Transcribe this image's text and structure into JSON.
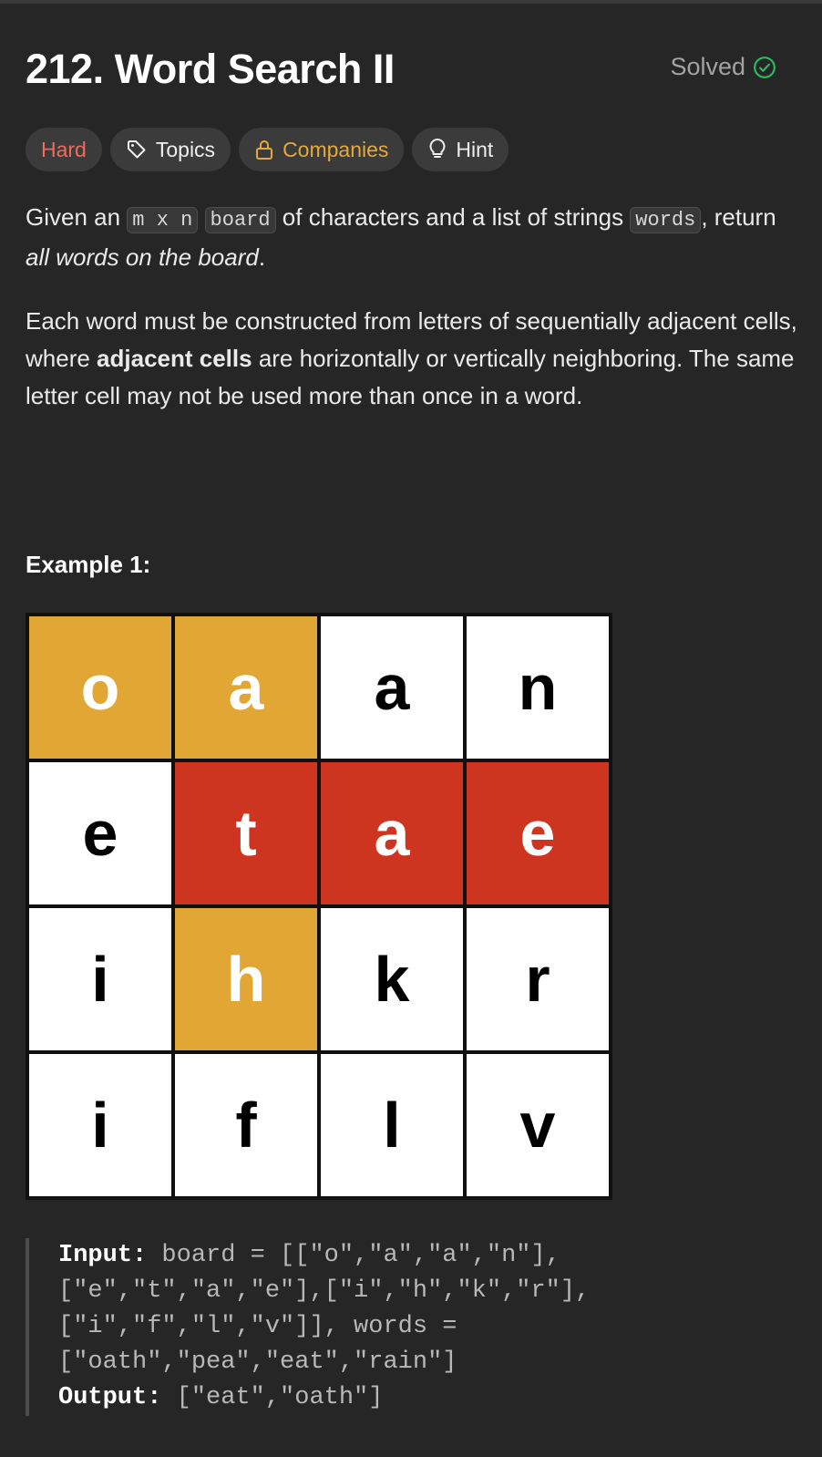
{
  "problem": {
    "title": "212. Word Search II",
    "status": "Solved",
    "status_color": "#2cbb5d"
  },
  "tags": {
    "difficulty": "Hard",
    "topics": "Topics",
    "companies": "Companies",
    "hint": "Hint",
    "difficulty_color": "#ef6a5b",
    "companies_color": "#e5a93a",
    "icons": {
      "topics": "tag-icon",
      "companies": "lock-icon",
      "hint": "lightbulb-icon",
      "status": "check-circle-icon"
    }
  },
  "description": {
    "p1_a": "Given an ",
    "p1_code1": "m x n",
    "p1_code2": "board",
    "p1_b": " of characters and a list of strings ",
    "p1_code3": "words",
    "p1_c": ", return ",
    "p1_em": "all words on the board",
    "p1_d": ".",
    "p2_a": "Each word must be constructed from letters of sequentially adjacent cells, where ",
    "p2_bold": "adjacent cells",
    "p2_b": " are horizontally or vertically neighboring. The same letter cell may not be used more than once in a word."
  },
  "example": {
    "title": "Example 1:",
    "board": [
      [
        "o",
        "a",
        "a",
        "n"
      ],
      [
        "e",
        "t",
        "a",
        "e"
      ],
      [
        "i",
        "h",
        "k",
        "r"
      ],
      [
        "i",
        "f",
        "l",
        "v"
      ]
    ],
    "highlight_colors": {
      "orange": "#e2a634",
      "red": "#ce3520"
    },
    "input_label": "Input:",
    "input_value": " board = [[\"o\",\"a\",\"a\",\"n\"],[\"e\",\"t\",\"a\",\"e\"],[\"i\",\"h\",\"k\",\"r\"],[\"i\",\"f\",\"l\",\"v\"]], words = [\"oath\",\"pea\",\"eat\",\"rain\"]",
    "output_label": "Output:",
    "output_value": " [\"eat\",\"oath\"]"
  }
}
